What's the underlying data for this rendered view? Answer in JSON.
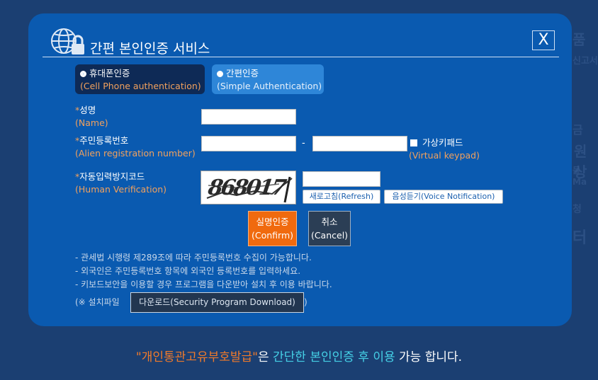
{
  "modal": {
    "title": "간편 본인인증 서비스",
    "close_label": "X"
  },
  "tabs": [
    {
      "label": "휴대폰인증",
      "sub": "(Cell Phone authentication)",
      "selected": true
    },
    {
      "label": "간편인증",
      "sub": "(Simple Authentication)",
      "selected": false
    }
  ],
  "fields": {
    "name": {
      "label": "성명",
      "sub": "(Name)",
      "value": ""
    },
    "rrn": {
      "label": "주민등록번호",
      "sub": "(Alien registration number)",
      "value1": "",
      "value2": "",
      "separator": "-"
    },
    "virtual_keypad": {
      "label": "가상키패드",
      "sub": "(Virtual keypad)",
      "checked": false
    },
    "captcha": {
      "label": "자동입력방지코드",
      "sub": "(Human Verification)",
      "code": "868017",
      "value": ""
    }
  },
  "required_mark": "*",
  "buttons": {
    "refresh": "새로고침(Refresh)",
    "voice": "음성듣기(Voice Notification)",
    "confirm_label": "실명인증",
    "confirm_sub": "(Confirm)",
    "cancel_label": "취소",
    "cancel_sub": "(Cancel)",
    "download": "다운로드(Security Program Download)"
  },
  "notes": [
    "- 관세법 시행령 제289조에 따라 주민등록번호 수집이 가능합니다.",
    "- 외국인은 주민등록번호 항목에 외국인 등록번호를 입력하세요.",
    "- 키보드보안을 이용할 경우 프로그램을 다운받아 설치 후 이용 바랍니다."
  ],
  "install_prefix": "(※ 설치파일",
  "install_suffix": ")",
  "footer": {
    "org": "\"개인통관고유부호발급\"",
    "part1": "은 ",
    "highlight": "간단한 본인인증 후 이용",
    "part2": " 가능 합니다."
  },
  "colors": {
    "page_bg": "#1b3f72",
    "modal_bg": "#0a5ab0",
    "accent_orange": "#f06a0e",
    "highlight_cyan": "#45d0e6"
  }
}
